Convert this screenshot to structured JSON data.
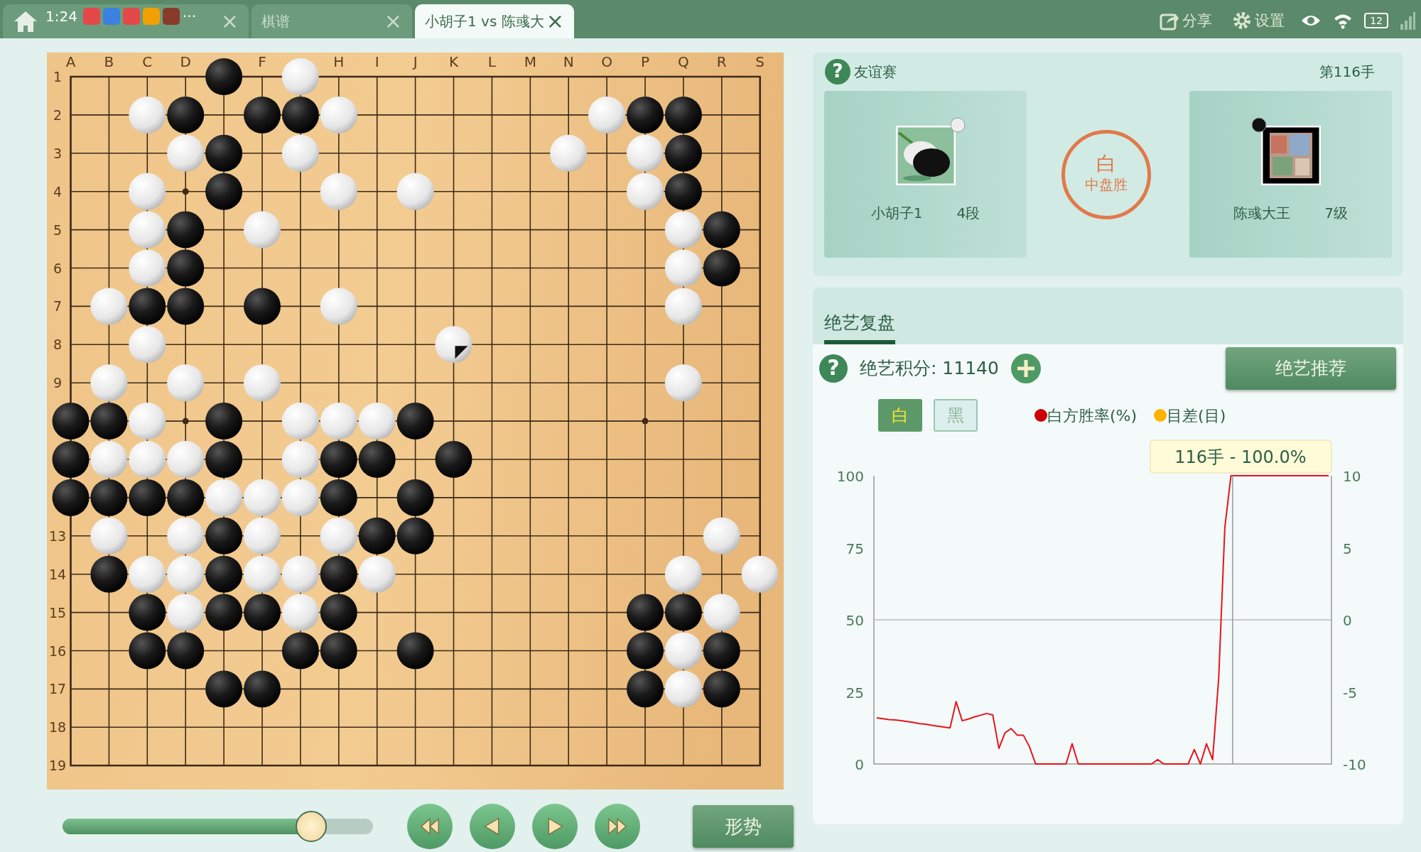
{
  "status_bar": {
    "time": "1:24",
    "more": "···",
    "battery": "12"
  },
  "tabs": [
    {
      "kind": "home",
      "close": "×",
      "selected": false
    },
    {
      "kind": "text",
      "label": "棋谱",
      "close": "×",
      "selected": false
    },
    {
      "kind": "text",
      "label": "小胡子1 vs 陈彧大",
      "close": "×",
      "selected": true
    }
  ],
  "top_actions": [
    {
      "kind": "share",
      "label": "分享"
    },
    {
      "kind": "settings",
      "label": "设置"
    }
  ],
  "board": {
    "column_labels": [
      {
        "label": "A"
      },
      {
        "label": "B"
      },
      {
        "label": "C"
      },
      {
        "label": "D"
      },
      {
        "kind": "covered"
      },
      {
        "label": "F"
      },
      {
        "kind": "covered"
      },
      {
        "label": "H"
      },
      {
        "label": "I"
      },
      {
        "label": "J"
      },
      {
        "label": "K"
      },
      {
        "label": "L"
      },
      {
        "label": "M"
      },
      {
        "label": "N"
      },
      {
        "label": "O"
      },
      {
        "label": "P"
      },
      {
        "label": "Q"
      },
      {
        "label": "R"
      },
      {
        "label": "S"
      }
    ],
    "row_labels": [
      {
        "label": "1"
      },
      {
        "label": "2"
      },
      {
        "label": "3"
      },
      {
        "label": "4"
      },
      {
        "label": "5"
      },
      {
        "label": "6"
      },
      {
        "label": "7"
      },
      {
        "label": "8"
      },
      {
        "label": "9"
      },
      {
        "kind": "covered"
      },
      {
        "kind": "covered"
      },
      {
        "kind": "covered"
      },
      {
        "label": "13"
      },
      {
        "label": "14"
      },
      {
        "label": "15"
      },
      {
        "label": "16"
      },
      {
        "label": "17"
      },
      {
        "label": "18"
      },
      {
        "label": "19"
      }
    ],
    "rows": [
      [
        null,
        null,
        null,
        null,
        {
          "kind": "black"
        },
        null,
        {
          "kind": "white"
        },
        null,
        null,
        null,
        null,
        null,
        null,
        null,
        null,
        null,
        null,
        null,
        null
      ],
      [
        null,
        null,
        {
          "kind": "white"
        },
        {
          "kind": "black"
        },
        null,
        {
          "kind": "black"
        },
        {
          "kind": "black"
        },
        {
          "kind": "white"
        },
        null,
        null,
        null,
        null,
        null,
        null,
        {
          "kind": "white"
        },
        {
          "kind": "black"
        },
        {
          "kind": "black"
        },
        null,
        null
      ],
      [
        null,
        null,
        null,
        {
          "kind": "white"
        },
        {
          "kind": "black"
        },
        null,
        {
          "kind": "white"
        },
        null,
        null,
        null,
        null,
        null,
        null,
        {
          "kind": "white"
        },
        null,
        {
          "kind": "white"
        },
        {
          "kind": "black"
        },
        null,
        null
      ],
      [
        null,
        null,
        {
          "kind": "white"
        },
        null,
        {
          "kind": "black"
        },
        null,
        null,
        {
          "kind": "white"
        },
        null,
        {
          "kind": "white"
        },
        null,
        null,
        null,
        null,
        null,
        {
          "kind": "white"
        },
        {
          "kind": "black"
        },
        null,
        null
      ],
      [
        null,
        null,
        {
          "kind": "white"
        },
        {
          "kind": "black"
        },
        null,
        {
          "kind": "white"
        },
        null,
        null,
        null,
        null,
        null,
        null,
        null,
        null,
        null,
        null,
        {
          "kind": "white"
        },
        {
          "kind": "black"
        },
        null
      ],
      [
        null,
        null,
        {
          "kind": "white"
        },
        {
          "kind": "black"
        },
        null,
        null,
        null,
        null,
        null,
        null,
        null,
        null,
        null,
        null,
        null,
        null,
        {
          "kind": "white"
        },
        {
          "kind": "black"
        },
        null
      ],
      [
        null,
        {
          "kind": "white"
        },
        {
          "kind": "black"
        },
        {
          "kind": "black"
        },
        null,
        {
          "kind": "black"
        },
        null,
        {
          "kind": "white"
        },
        null,
        null,
        null,
        null,
        null,
        null,
        null,
        null,
        {
          "kind": "white"
        },
        null,
        null
      ],
      [
        null,
        null,
        {
          "kind": "white"
        },
        null,
        null,
        null,
        null,
        null,
        null,
        null,
        {
          "kind": "marked"
        },
        null,
        null,
        null,
        null,
        null,
        null,
        null,
        null
      ],
      [
        null,
        {
          "kind": "white"
        },
        null,
        {
          "kind": "white"
        },
        null,
        {
          "kind": "white"
        },
        null,
        null,
        null,
        null,
        null,
        null,
        null,
        null,
        null,
        null,
        {
          "kind": "white"
        },
        null,
        null
      ],
      [
        {
          "kind": "black"
        },
        {
          "kind": "black"
        },
        {
          "kind": "white"
        },
        null,
        {
          "kind": "black"
        },
        null,
        {
          "kind": "white"
        },
        {
          "kind": "white"
        },
        {
          "kind": "white"
        },
        {
          "kind": "black"
        },
        null,
        null,
        null,
        null,
        null,
        null,
        null,
        null,
        null
      ],
      [
        {
          "kind": "black"
        },
        {
          "kind": "white"
        },
        {
          "kind": "white"
        },
        {
          "kind": "white"
        },
        {
          "kind": "black"
        },
        null,
        {
          "kind": "white"
        },
        {
          "kind": "black"
        },
        {
          "kind": "black"
        },
        null,
        {
          "kind": "black"
        },
        null,
        null,
        null,
        null,
        null,
        null,
        null,
        null
      ],
      [
        {
          "kind": "black"
        },
        {
          "kind": "black"
        },
        {
          "kind": "black"
        },
        {
          "kind": "black"
        },
        {
          "kind": "white"
        },
        {
          "kind": "white"
        },
        {
          "kind": "white"
        },
        {
          "kind": "black"
        },
        null,
        {
          "kind": "black"
        },
        null,
        null,
        null,
        null,
        null,
        null,
        null,
        null,
        null
      ],
      [
        null,
        {
          "kind": "white"
        },
        null,
        {
          "kind": "white"
        },
        {
          "kind": "black"
        },
        {
          "kind": "white"
        },
        null,
        {
          "kind": "white"
        },
        {
          "kind": "black"
        },
        {
          "kind": "black"
        },
        null,
        null,
        null,
        null,
        null,
        null,
        null,
        {
          "kind": "white"
        },
        null
      ],
      [
        null,
        {
          "kind": "black"
        },
        {
          "kind": "white"
        },
        {
          "kind": "white"
        },
        {
          "kind": "black"
        },
        {
          "kind": "white"
        },
        {
          "kind": "white"
        },
        {
          "kind": "black"
        },
        {
          "kind": "white"
        },
        null,
        null,
        null,
        null,
        null,
        null,
        null,
        {
          "kind": "white"
        },
        null,
        {
          "kind": "white"
        }
      ],
      [
        null,
        null,
        {
          "kind": "black"
        },
        {
          "kind": "white"
        },
        {
          "kind": "black"
        },
        {
          "kind": "black"
        },
        {
          "kind": "white"
        },
        {
          "kind": "black"
        },
        null,
        null,
        null,
        null,
        null,
        null,
        null,
        {
          "kind": "black"
        },
        {
          "kind": "black"
        },
        {
          "kind": "white"
        },
        null
      ],
      [
        null,
        null,
        {
          "kind": "black"
        },
        {
          "kind": "black"
        },
        null,
        null,
        {
          "kind": "black"
        },
        {
          "kind": "black"
        },
        null,
        {
          "kind": "black"
        },
        null,
        null,
        null,
        null,
        null,
        {
          "kind": "black"
        },
        {
          "kind": "white"
        },
        {
          "kind": "black"
        },
        null
      ],
      [
        null,
        null,
        null,
        null,
        {
          "kind": "black"
        },
        {
          "kind": "black"
        },
        null,
        null,
        null,
        null,
        null,
        null,
        null,
        null,
        null,
        {
          "kind": "black"
        },
        {
          "kind": "white"
        },
        {
          "kind": "black"
        },
        null
      ],
      [
        null,
        null,
        null,
        null,
        null,
        null,
        null,
        null,
        null,
        null,
        null,
        null,
        null,
        null,
        null,
        null,
        null,
        null,
        null
      ],
      [
        null,
        null,
        null,
        null,
        null,
        null,
        null,
        null,
        null,
        null,
        null,
        null,
        null,
        null,
        null,
        null,
        null,
        null,
        null
      ]
    ]
  },
  "move_slider": {
    "level": 0.8
  },
  "playback_buttons": [
    {
      "kind": "first"
    },
    {
      "kind": "prev"
    },
    {
      "kind": "next"
    },
    {
      "kind": "last"
    }
  ],
  "situation_button": "形势",
  "match": {
    "help_icon": "?",
    "type": "友谊赛",
    "move": "第116手",
    "players": [
      {
        "name": "小胡子1",
        "rank": "4段",
        "kind": "white"
      },
      {
        "name": "陈彧大王",
        "rank": "7级",
        "kind": "black"
      }
    ],
    "result": {
      "winner": "白",
      "method": "中盘胜"
    }
  },
  "review": {
    "tab": "绝艺复盘",
    "help_icon": "?",
    "score_label": "绝艺积分: 11140",
    "recommend_button": "绝艺推荐",
    "side_toggle": [
      {
        "label": "白",
        "selected": true
      },
      {
        "label": "黑",
        "selected": false
      }
    ],
    "legend": [
      {
        "label": "白方胜率(%)",
        "color": "#cc0000"
      },
      {
        "label": "目差(目)",
        "color": "#ffb400"
      }
    ],
    "tooltip": "116手 - 100.0%",
    "right_axis_labels": [
      "10",
      "5",
      "0",
      "-5",
      "-10"
    ],
    "chart_data": {
      "type": "line",
      "categories": [
        null,
        null,
        null,
        null,
        null,
        null,
        null,
        null,
        null,
        null,
        null,
        null,
        null,
        null,
        null,
        null,
        null,
        null,
        null,
        null,
        null,
        null,
        null,
        null,
        null,
        null,
        null,
        null,
        null,
        null,
        null,
        null,
        null,
        null,
        null,
        null,
        null,
        null,
        null,
        null,
        null,
        null,
        null,
        null,
        null,
        null,
        null,
        null,
        null,
        null,
        null,
        null,
        null,
        null,
        null,
        null,
        null,
        null,
        null,
        null,
        null,
        null,
        null,
        null,
        null,
        null,
        null,
        null,
        null,
        null,
        null,
        null,
        null,
        null,
        null
      ],
      "series": [
        {
          "color": "#e8141a",
          "values": [
            16,
            15.7,
            15.4,
            15.3,
            15,
            14.7,
            14.4,
            14,
            13.8,
            13.4,
            13.1,
            12.8,
            12.5,
            21.6,
            15,
            15.6,
            16.3,
            16.9,
            17.5,
            17,
            5.4,
            10.8,
            12.3,
            10,
            10,
            6,
            0,
            0,
            0,
            0,
            0,
            0,
            7,
            0,
            0,
            0,
            0,
            0,
            0,
            0,
            0,
            0,
            0,
            0,
            0,
            0,
            1.5,
            0,
            0,
            0,
            0,
            0,
            5,
            0,
            7,
            1.5,
            30,
            82,
            100,
            100,
            100,
            100,
            100,
            100,
            100,
            100,
            100,
            100,
            100,
            100,
            100,
            100,
            100,
            100,
            100
          ]
        }
      ],
      "ylim": [
        0,
        100
      ],
      "yticks": [
        0,
        25,
        50,
        75,
        100
      ],
      "ref_lines": [
        {
          "axis": "y",
          "value": 50
        }
      ]
    }
  }
}
